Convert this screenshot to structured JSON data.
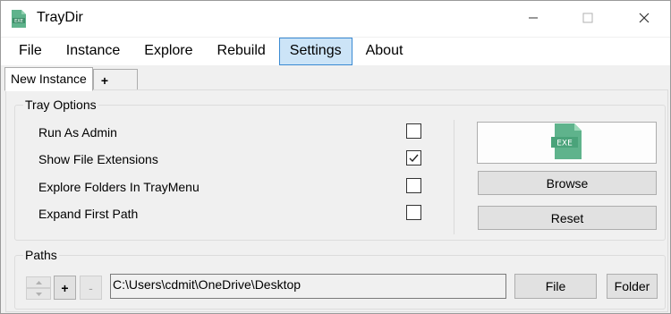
{
  "window": {
    "title": "TrayDir",
    "app_icon": "exe-file-icon"
  },
  "controls": {
    "minimize_icon": "minimize-icon",
    "maximize_icon": "maximize-icon",
    "close_icon": "close-icon"
  },
  "menu": {
    "items": [
      {
        "label": "File",
        "active": false
      },
      {
        "label": "Instance",
        "active": false
      },
      {
        "label": "Explore",
        "active": false
      },
      {
        "label": "Rebuild",
        "active": false
      },
      {
        "label": "Settings",
        "active": true
      },
      {
        "label": "About",
        "active": false
      }
    ]
  },
  "tabs": {
    "items": [
      {
        "label": "New Instance",
        "selected": true
      },
      {
        "label": "+",
        "selected": false
      }
    ]
  },
  "tray_options": {
    "title": "Tray Options",
    "options": [
      {
        "label": "Run As Admin",
        "checked": false
      },
      {
        "label": "Show File Extensions",
        "checked": true
      },
      {
        "label": "Explore Folders In TrayMenu",
        "checked": false
      },
      {
        "label": "Expand First Path",
        "checked": false
      }
    ],
    "icon_button_label": "EXE",
    "browse_label": "Browse",
    "reset_label": "Reset"
  },
  "paths": {
    "title": "Paths",
    "add_label": "+",
    "remove_label": "-",
    "current_path": "C:\\Users\\cdmit\\OneDrive\\Desktop",
    "file_label": "File",
    "folder_label": "Folder"
  },
  "colors": {
    "menu_active_bg": "#cce4f7",
    "menu_active_border": "#3a8ad3",
    "exe_icon_green": "#5fb38c"
  }
}
